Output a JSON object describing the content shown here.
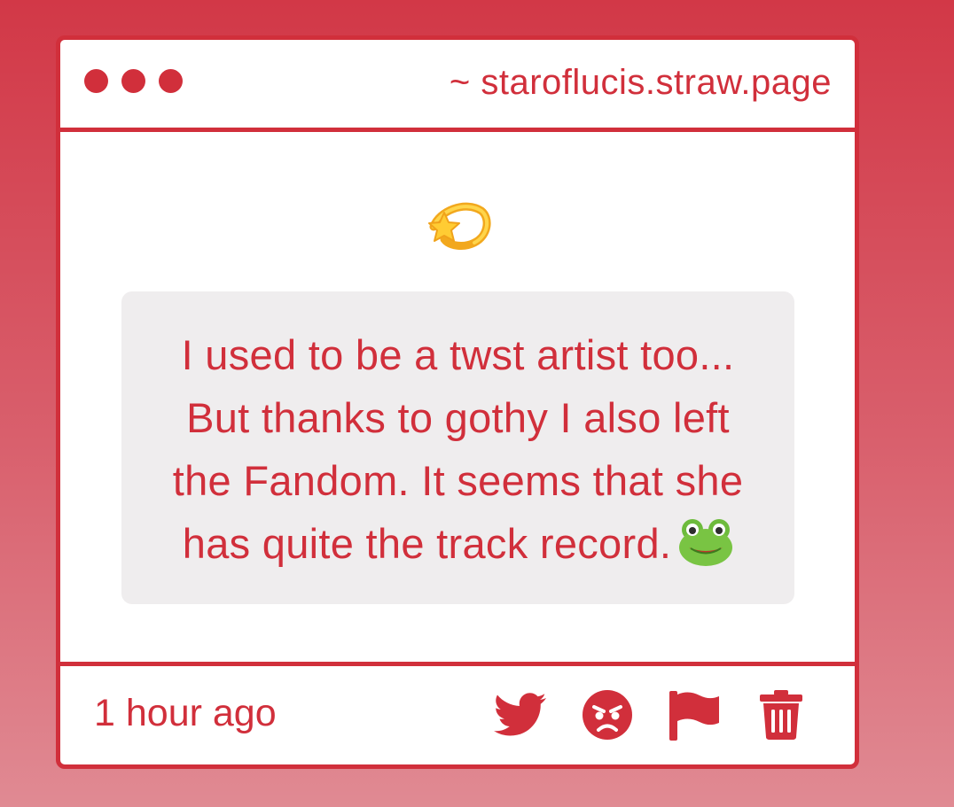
{
  "window": {
    "url": "~ staroflucis.straw.page"
  },
  "post": {
    "emoji_icon": "dizzy-star-icon",
    "message": "I used to be a twst artist too... But thanks to gothy I also left the Fandom. It seems that she has quite the track record.",
    "message_lines": [
      "I used to be a twst artist too...",
      "But thanks to gothy I also left",
      "the Fandom. It seems that she",
      "has quite the track record."
    ],
    "trailing_emoji_icon": "frog-icon"
  },
  "footer": {
    "timestamp": "1 hour ago",
    "actions": [
      {
        "icon": "twitter-icon"
      },
      {
        "icon": "angry-face-icon"
      },
      {
        "icon": "flag-icon"
      },
      {
        "icon": "trash-icon"
      }
    ]
  },
  "colors": {
    "accent": "#d12f3b",
    "background_top": "#d23847",
    "background_bottom": "#e08a93",
    "message_bg": "#efedee"
  }
}
